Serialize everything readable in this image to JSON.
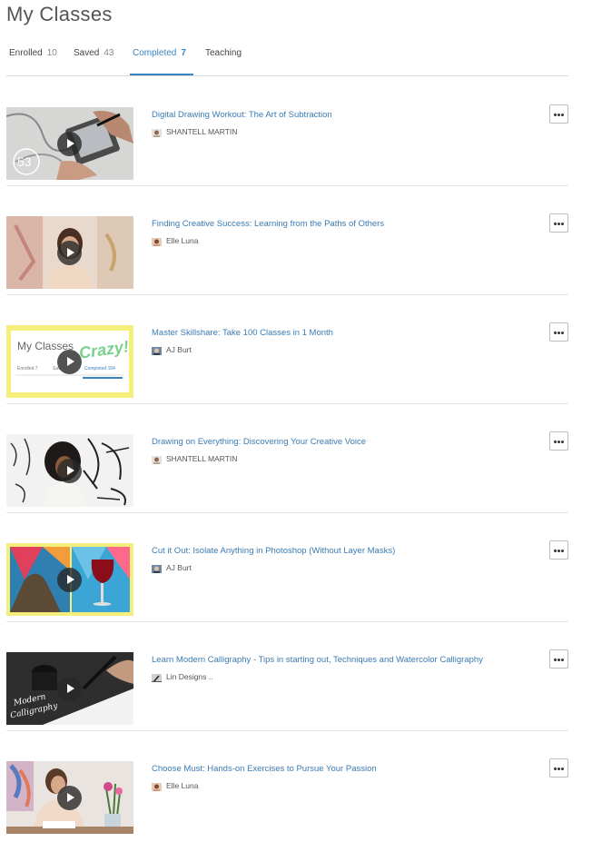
{
  "page": {
    "title": "My Classes"
  },
  "tabs": [
    {
      "label": "Enrolled",
      "count": "10",
      "active": false
    },
    {
      "label": "Saved",
      "count": "43",
      "active": false
    },
    {
      "label": "Completed",
      "count": "7",
      "active": true
    },
    {
      "label": "Teaching",
      "count": "",
      "active": false
    }
  ],
  "classes": [
    {
      "title": "Digital Drawing Workout: The Art of Subtraction",
      "teacher": "SHANTELL MARTIN",
      "thumbnail_badge": "53",
      "thumbnail_icon": "drawing-tablet-thumbnail",
      "more_icon": "ellipsis-icon"
    },
    {
      "title": "Finding Creative Success: Learning from the Paths of Others",
      "teacher": "Elle Luna",
      "thumbnail_icon": "woman-portrait-thumbnail",
      "more_icon": "ellipsis-icon"
    },
    {
      "title": "Master Skillshare: Take 100 Classes in 1 Month",
      "teacher": "AJ Burt",
      "thumbnail_icon": "my-classes-screenshot-thumbnail",
      "thumbnail_text": {
        "heading": "My Classes",
        "stamp": "Crazy!",
        "tab_enrolled": "Enrolled",
        "tab_enrolled_count": "7",
        "tab_saved": "Sav",
        "tab_completed": "Completed",
        "tab_completed_count": "104"
      },
      "more_icon": "ellipsis-icon"
    },
    {
      "title": "Drawing on Everything: Discovering Your Creative Voice",
      "teacher": "SHANTELL MARTIN",
      "thumbnail_icon": "artist-portrait-thumbnail",
      "more_icon": "ellipsis-icon"
    },
    {
      "title": "Cut it Out: Isolate Anything in Photoshop (Without Layer Masks)",
      "teacher": "AJ Burt",
      "thumbnail_icon": "photoshop-collage-thumbnail",
      "more_icon": "ellipsis-icon"
    },
    {
      "title": "Learn Modern Calligraphy - Tips in starting out, Techniques and Watercolor Calligraphy",
      "teacher": "Lin Designs ..",
      "thumbnail_icon": "calligraphy-pen-thumbnail",
      "thumbnail_text": {
        "line1": "Modern",
        "line2": "Calligraphy"
      },
      "more_icon": "ellipsis-icon"
    },
    {
      "title": "Choose Must: Hands-on Exercises to Pursue Your Passion",
      "teacher": "Elle Luna",
      "thumbnail_icon": "woman-at-desk-thumbnail",
      "more_icon": "ellipsis-icon"
    }
  ],
  "colors": {
    "accent": "#3a84c0",
    "link": "#3a7bb5",
    "divider": "#e5e5e5"
  }
}
